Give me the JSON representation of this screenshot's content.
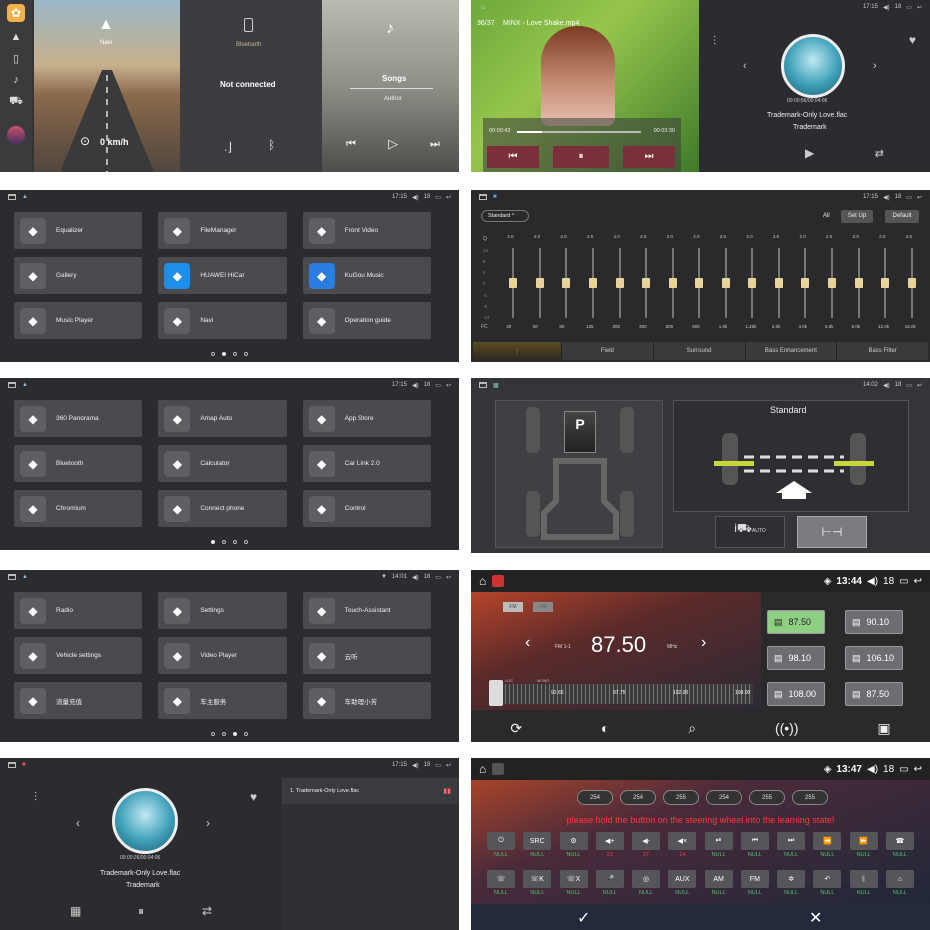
{
  "p1": {
    "nav": "Navi",
    "speed": "0 km/h",
    "bt_label": "Bluetooth",
    "bt_status": "Not connected",
    "song": "Songs",
    "author": "Author"
  },
  "p2": {
    "track_idx": "36/37",
    "track_title": "MINX - Love Shake.mp4",
    "t_cur": "00:00:43",
    "t_end": "00:03:30",
    "time": "17:15",
    "vol": "18",
    "mtime": "00:00:56/00:04:06",
    "mtitle": "Trademark-Only Love.flac",
    "martist": "Trademark"
  },
  "p3": {
    "time": "17:15",
    "vol": "18",
    "apps": [
      "Equalizer",
      "FileManager",
      "Front Video",
      "Gallery",
      "HUAWEI HiCar",
      "KuGou Music",
      "Music Player",
      "Navi",
      "Operation guide"
    ],
    "icons": [
      "sliders-icon",
      "layers-icon",
      "camera-icon",
      "image-icon",
      "hicar-icon",
      "kugou-icon",
      "music-note-icon",
      "navigation-icon",
      "guide-icon"
    ]
  },
  "p4": {
    "time": "17:15",
    "vol": "18",
    "preset": "Standard",
    "all": "All",
    "setup": "Set Up",
    "default": "Default",
    "scale": [
      "12",
      "8",
      "4",
      "0",
      "-4",
      "-8",
      "-12"
    ],
    "q": "Q",
    "fc": "FC",
    "bands": [
      {
        "q": "2.0",
        "f": "30"
      },
      {
        "q": "2.0",
        "f": "50"
      },
      {
        "q": "2.0",
        "f": "80"
      },
      {
        "q": "2.0",
        "f": "125"
      },
      {
        "q": "2.0",
        "f": "200"
      },
      {
        "q": "2.0",
        "f": "300"
      },
      {
        "q": "2.0",
        "f": "500"
      },
      {
        "q": "2.0",
        "f": "800"
      },
      {
        "q": "2.0",
        "f": "1.0k"
      },
      {
        "q": "2.0",
        "f": "1.25k"
      },
      {
        "q": "2.0",
        "f": "2.0k"
      },
      {
        "q": "2.0",
        "f": "3.0k"
      },
      {
        "q": "2.0",
        "f": "5.0k"
      },
      {
        "q": "2.0",
        "f": "8.0k"
      },
      {
        "q": "2.0",
        "f": "12.0k"
      },
      {
        "q": "2.0",
        "f": "16.0k"
      }
    ],
    "tabs": [
      "Field",
      "Surround",
      "Bass Enhancement",
      "Bass Filter"
    ]
  },
  "p5": {
    "time": "17:15",
    "vol": "18",
    "apps": [
      "360 Panorama",
      "Amap Auto",
      "App Store",
      "Bluetooth",
      "Calculator",
      "Car Link 2.0",
      "Chromium",
      "Connect phone",
      "Control"
    ],
    "icons": [
      "panorama-icon",
      "amap-icon",
      "store-icon",
      "bluetooth-icon",
      "calculator-icon",
      "carlink-icon",
      "chromium-icon",
      "connect-icon",
      "steering-icon"
    ]
  },
  "p6": {
    "time": "14:02",
    "vol": "18",
    "gear": "P",
    "mode": "Standard",
    "auto": "AUTO"
  },
  "p7": {
    "time": "14:01",
    "vol": "18",
    "apps": [
      "Radio",
      "Settings",
      "Touch-Assistant",
      "Vehicle settings",
      "Video Player",
      "云听",
      "流量充值",
      "车主服务",
      "车助理小芳"
    ],
    "icons": [
      "radio-icon",
      "gear-icon",
      "touch-icon",
      "vehicle-icon",
      "video-icon",
      "yunting-icon",
      "recharge-icon",
      "service-icon",
      "mic-icon"
    ]
  },
  "p8": {
    "time": "13:44",
    "vol": "18",
    "fm": "FM",
    "am": "AM",
    "band": "FM 1-1",
    "freq": "87.50",
    "unit": "MHz",
    "loc": "LOC",
    "mono": "MONO",
    "scale": [
      "92.65",
      "97.75",
      "102.90",
      "108.00"
    ],
    "presets": [
      "87.50",
      "90.10",
      "98.10",
      "106.10",
      "108.00",
      "87.50"
    ]
  },
  "p9": {
    "time": "17:15",
    "vol": "18",
    "mtime": "00:00:26/00:04:06",
    "mtitle": "Trademark-Only Love.flac",
    "martist": "Trademark",
    "pl_item": "1. Trademark-Only Love.flac"
  },
  "p10": {
    "time": "13:47",
    "vol": "18",
    "pills": [
      "254",
      "254",
      "255",
      "254",
      "255",
      "255"
    ],
    "message": "please hold the button on the steering wheel into the learning state!",
    "row1": [
      {
        "k": "⏻",
        "v": "NULL"
      },
      {
        "k": "SRC",
        "v": "NULL"
      },
      {
        "k": "⚙",
        "v": "NULL"
      },
      {
        "k": "◀+",
        "v": "23",
        "r": true
      },
      {
        "k": "◀-",
        "v": "27",
        "r": true
      },
      {
        "k": "◀×",
        "v": "14",
        "r": true
      },
      {
        "k": "⏯",
        "v": "NULL"
      },
      {
        "k": "⏮",
        "v": "NULL"
      },
      {
        "k": "⏭",
        "v": "NULL"
      },
      {
        "k": "⏪",
        "v": "NULL"
      },
      {
        "k": "⏩",
        "v": "NULL"
      },
      {
        "k": "☎",
        "v": "NULL"
      }
    ],
    "row2": [
      {
        "k": "☏",
        "v": "NULL"
      },
      {
        "k": "☏K",
        "v": "NULL"
      },
      {
        "k": "☏X",
        "v": "NULL"
      },
      {
        "k": "🎤",
        "v": "NULL"
      },
      {
        "k": "◎",
        "v": "NULL"
      },
      {
        "k": "AUX",
        "v": "NULL"
      },
      {
        "k": "AM",
        "v": "NULL"
      },
      {
        "k": "FM",
        "v": "NULL"
      },
      {
        "k": "✲",
        "v": "NULL"
      },
      {
        "k": "↶",
        "v": "NULL"
      },
      {
        "k": "ᛒ",
        "v": "NULL"
      },
      {
        "k": "⌂",
        "v": "NULL"
      }
    ]
  }
}
